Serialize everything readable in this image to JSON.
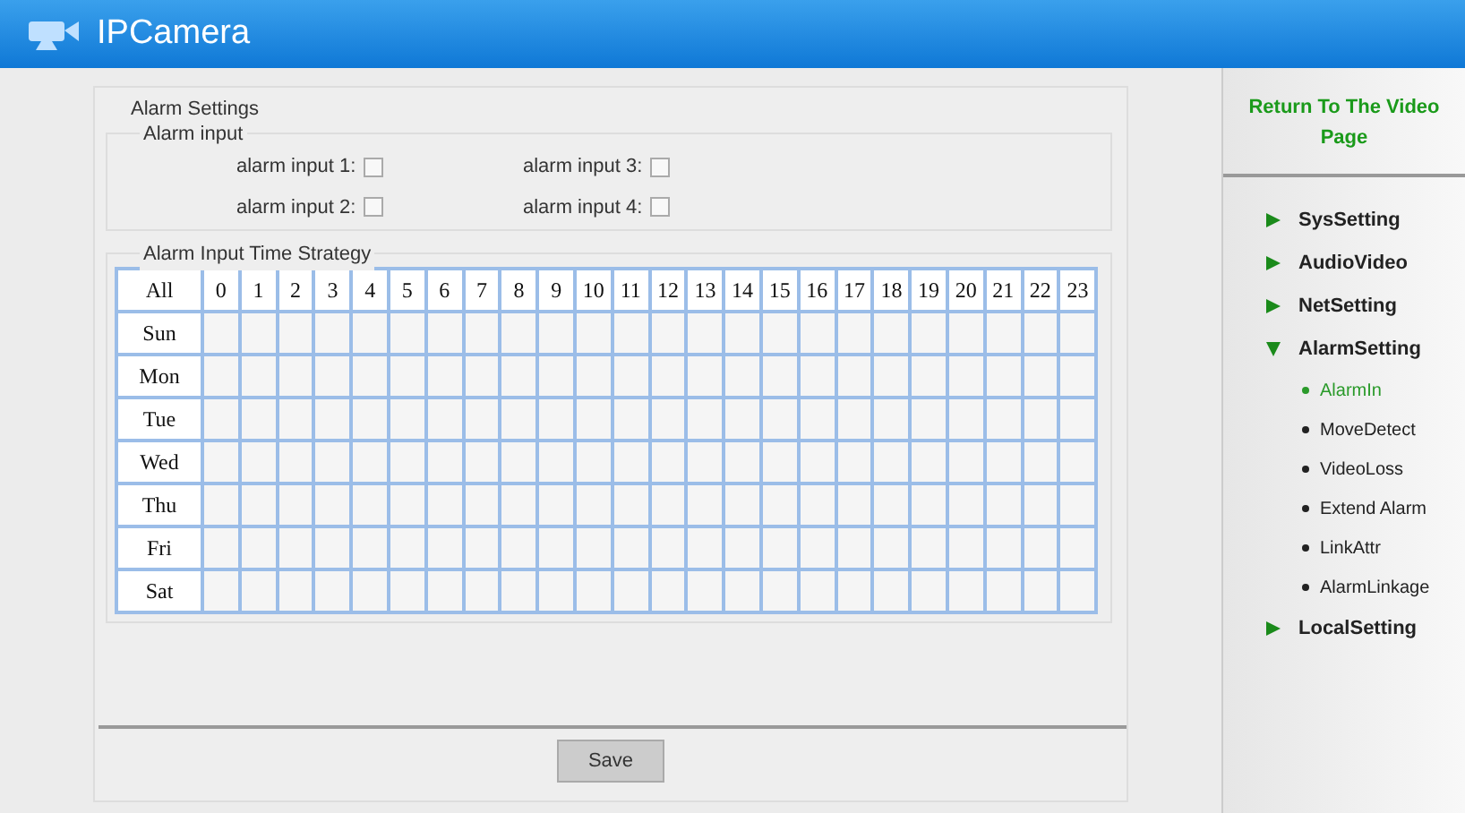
{
  "header": {
    "title": "IPCamera"
  },
  "panel": {
    "title": "Alarm Settings",
    "alarm_input": {
      "title": "Alarm input",
      "inputs": [
        {
          "label": "alarm input 1:",
          "checked": false
        },
        {
          "label": "alarm input 3:",
          "checked": false
        },
        {
          "label": "alarm input 2:",
          "checked": false
        },
        {
          "label": "alarm input 4:",
          "checked": false
        }
      ]
    },
    "schedule": {
      "title": "Alarm Input Time Strategy",
      "corner": "All",
      "hours": [
        "0",
        "1",
        "2",
        "3",
        "4",
        "5",
        "6",
        "7",
        "8",
        "9",
        "10",
        "11",
        "12",
        "13",
        "14",
        "15",
        "16",
        "17",
        "18",
        "19",
        "20",
        "21",
        "22",
        "23"
      ],
      "days": [
        "Sun",
        "Mon",
        "Tue",
        "Wed",
        "Thu",
        "Fri",
        "Sat"
      ]
    },
    "save_button": "Save"
  },
  "sidebar": {
    "return_link": "Return To The Video Page",
    "items": [
      {
        "label": "SysSetting",
        "expanded": false
      },
      {
        "label": "AudioVideo",
        "expanded": false
      },
      {
        "label": "NetSetting",
        "expanded": false
      },
      {
        "label": "AlarmSetting",
        "expanded": true,
        "children": [
          {
            "label": "AlarmIn",
            "selected": true
          },
          {
            "label": "MoveDetect",
            "selected": false
          },
          {
            "label": "VideoLoss",
            "selected": false
          },
          {
            "label": "Extend Alarm",
            "selected": false
          },
          {
            "label": "LinkAttr",
            "selected": false
          },
          {
            "label": "AlarmLinkage",
            "selected": false
          }
        ]
      },
      {
        "label": "LocalSetting",
        "expanded": false
      }
    ]
  }
}
